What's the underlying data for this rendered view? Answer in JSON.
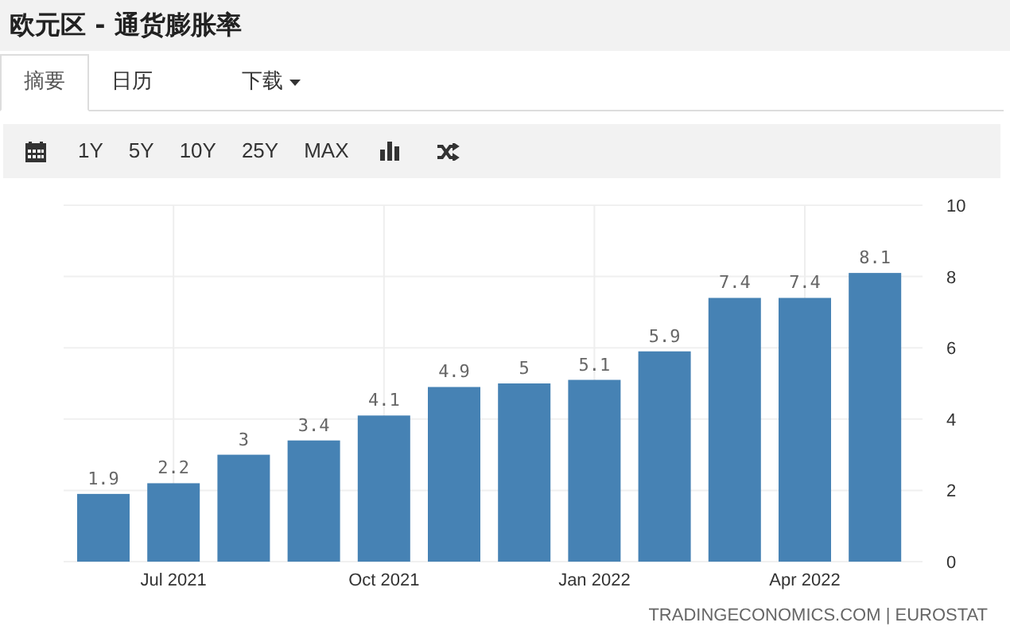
{
  "title": "欧元区 - 通货膨胀率",
  "tabs": [
    {
      "label": "摘要",
      "selected": true
    },
    {
      "label": "日历",
      "selected": false
    },
    {
      "label": "下载",
      "selected": false,
      "kind": "dropdown"
    }
  ],
  "toolbar": [
    {
      "kind": "calendar"
    },
    {
      "kind": "text",
      "label": "1Y"
    },
    {
      "kind": "text",
      "label": "5Y"
    },
    {
      "kind": "text",
      "label": "10Y"
    },
    {
      "kind": "text",
      "label": "25Y"
    },
    {
      "kind": "text",
      "label": "MAX"
    },
    {
      "kind": "bars"
    },
    {
      "kind": "shuffle"
    }
  ],
  "chart_data": {
    "type": "bar",
    "grid": true,
    "categories": [
      null,
      "Jul 2021",
      null,
      null,
      "Oct 2021",
      null,
      null,
      "Jan 2022",
      null,
      null,
      "Apr 2022",
      null
    ],
    "series": [
      {
        "color": "#4682b4",
        "values": [
          1.9,
          2.2,
          3,
          3.4,
          4.1,
          4.9,
          5,
          5.1,
          5.9,
          7.4,
          7.4,
          8.1
        ]
      }
    ],
    "value_labels": [
      "1.9",
      "2.2",
      "3",
      "3.4",
      "4.1",
      "4.9",
      "5",
      "5.1",
      "5.9",
      "7.4",
      "7.4",
      "8.1"
    ],
    "ylim": [
      0,
      10
    ],
    "yticks": [
      0,
      2,
      4,
      6,
      8,
      10
    ]
  },
  "source": "TRADINGECONOMICS.COM | EUROSTAT"
}
